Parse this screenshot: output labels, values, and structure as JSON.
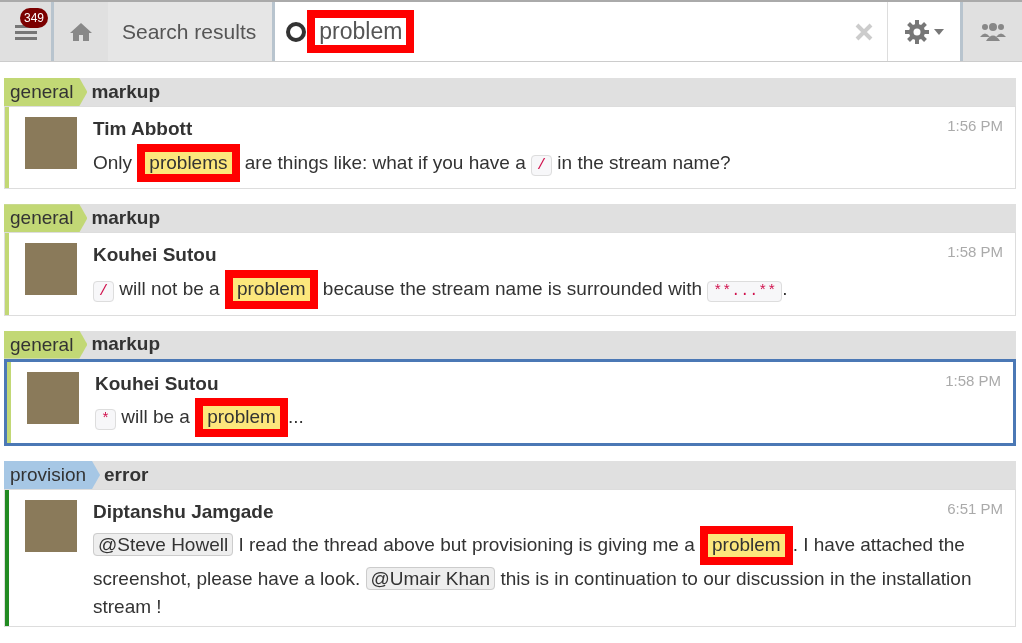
{
  "top_bar": {
    "unread_count": "349",
    "breadcrumb": "Search results",
    "search": {
      "value": "problem",
      "annotated": true
    }
  },
  "groups": [
    {
      "stream": "general",
      "color": "#c2d875",
      "topic": "markup",
      "messages": [
        {
          "sender": "Tim Abbott",
          "time": "1:56 PM",
          "selected": false,
          "color": "#c2d875",
          "parts": [
            {
              "kind": "text",
              "text": "Only "
            },
            {
              "kind": "highlight",
              "text": "problems",
              "annotated": true
            },
            {
              "kind": "text",
              "text": " are things like: what if you have a "
            },
            {
              "kind": "code",
              "text": "/"
            },
            {
              "kind": "text",
              "text": " in the stream name?"
            }
          ]
        }
      ]
    },
    {
      "stream": "general",
      "color": "#c2d875",
      "topic": "markup",
      "messages": [
        {
          "sender": "Kouhei Sutou",
          "time": "1:58 PM",
          "selected": false,
          "color": "#c2d875",
          "parts": [
            {
              "kind": "code",
              "text": "/"
            },
            {
              "kind": "text",
              "text": " will not be a "
            },
            {
              "kind": "highlight",
              "text": "problem",
              "annotated": true
            },
            {
              "kind": "text",
              "text": " because the stream name is surrounded with "
            },
            {
              "kind": "code",
              "text": "**...**"
            },
            {
              "kind": "text",
              "text": "."
            }
          ]
        }
      ]
    },
    {
      "stream": "general",
      "color": "#c2d875",
      "topic": "markup",
      "messages": [
        {
          "sender": "Kouhei Sutou",
          "time": "1:58 PM",
          "selected": true,
          "color": "#c2d875",
          "parts": [
            {
              "kind": "code",
              "text": "*"
            },
            {
              "kind": "text",
              "text": " will be a "
            },
            {
              "kind": "highlight",
              "text": "problem",
              "annotated": true
            },
            {
              "kind": "text",
              "text": "..."
            }
          ]
        }
      ]
    },
    {
      "stream": "provision",
      "color": "#a6c7e5",
      "topic": "error",
      "messages": [
        {
          "sender": "Diptanshu Jamgade",
          "time": "6:51 PM",
          "selected": false,
          "color": "#228b22",
          "parts": [
            {
              "kind": "mention",
              "text": "@Steve Howell"
            },
            {
              "kind": "text",
              "text": " I read the thread above but provisioning is giving me a "
            },
            {
              "kind": "highlight",
              "text": "problem",
              "annotated": true
            },
            {
              "kind": "text",
              "text": ". I have attached the screenshot, please have a look. "
            },
            {
              "kind": "mention",
              "text": "@Umair Khan"
            },
            {
              "kind": "text",
              "text": " this is in continuation to our discussion in the installation stream !"
            }
          ]
        }
      ]
    }
  ]
}
